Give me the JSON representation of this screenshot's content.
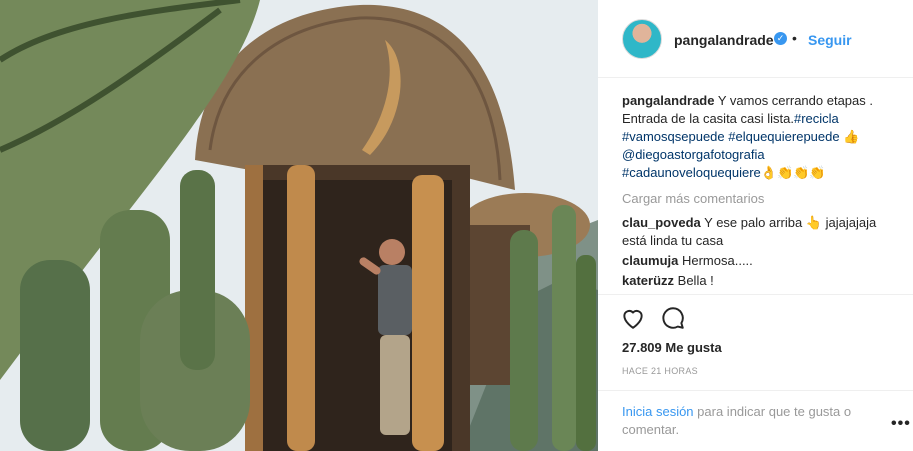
{
  "post": {
    "username": "pangalandrade",
    "verified_icon": "verified-badge-icon",
    "separator": "•",
    "follow_label": "Seguir",
    "caption": {
      "user": "pangalandrade",
      "text": "Y vamos cerrando etapas . Entrada de la casita casi lista.",
      "tags": [
        "#recicla",
        "#vamosqsepuede",
        "#elquequierepuede",
        "@diegoastorgafotografia",
        "#cadaunoveloquequiere"
      ],
      "emoji_1": "👍",
      "emoji_2": "👌👏👏👏"
    },
    "load_more": "Cargar más comentarios",
    "comments": [
      {
        "user": "clau_poveda",
        "text": "Y ese palo arriba 👆 jajajajaja está linda tu casa"
      },
      {
        "user": "claumuja",
        "text": "Hermosa....."
      },
      {
        "user": "katerüzz",
        "text": "Bella !"
      }
    ],
    "likes": "27.809 Me gusta",
    "timestamp": "HACE 21 HORAS",
    "login": {
      "link": "Inicia sesión",
      "text": "para indicar que te gusta o comentar."
    },
    "more_options": "•••"
  },
  "icons": {
    "like": "heart-icon",
    "comment": "comment-bubble-icon"
  },
  "colors": {
    "link": "#3897f0",
    "hashtag": "#003569",
    "muted": "#999999"
  }
}
